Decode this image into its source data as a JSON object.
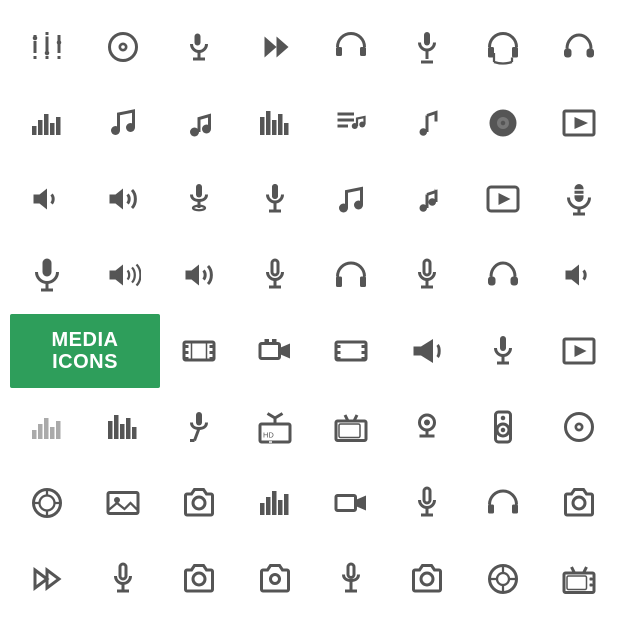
{
  "label": {
    "line1": "MEDIA",
    "line2": "ICONS"
  },
  "accent_color": "#2e9e5b",
  "icon_color": "#555555",
  "icon_light_color": "#aaaaaa"
}
